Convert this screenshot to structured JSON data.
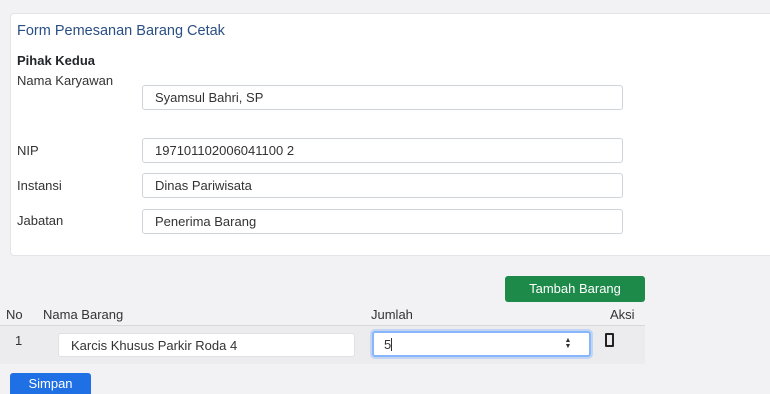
{
  "form": {
    "title": "Form Pemesanan Barang Cetak",
    "section": "Pihak Kedua",
    "fields": [
      {
        "label": "Nama Karyawan",
        "value": "Syamsul Bahri, SP"
      },
      {
        "label": "NIP",
        "value": "197101102006041100 2"
      },
      {
        "label": "Instansi",
        "value": "Dinas Pariwisata"
      },
      {
        "label": "Jabatan",
        "value": "Penerima Barang"
      }
    ]
  },
  "items": {
    "add_button": "Tambah Barang",
    "columns": [
      "No",
      "Nama Barang",
      "Jumlah",
      "Aksi"
    ],
    "rows": [
      {
        "no": "1",
        "nama": "Karcis Khusus Parkir Roda 4",
        "jumlah": "5"
      }
    ]
  },
  "save_button": "Simpan",
  "colors": {
    "title": "#2a4f84",
    "add_button": "#1e8a4a",
    "save_button": "#1f6fe5",
    "focus_border": "#86b7fe"
  },
  "icons": {
    "spinner": "spinner-arrows-icon",
    "aksi": "delete-icon"
  }
}
